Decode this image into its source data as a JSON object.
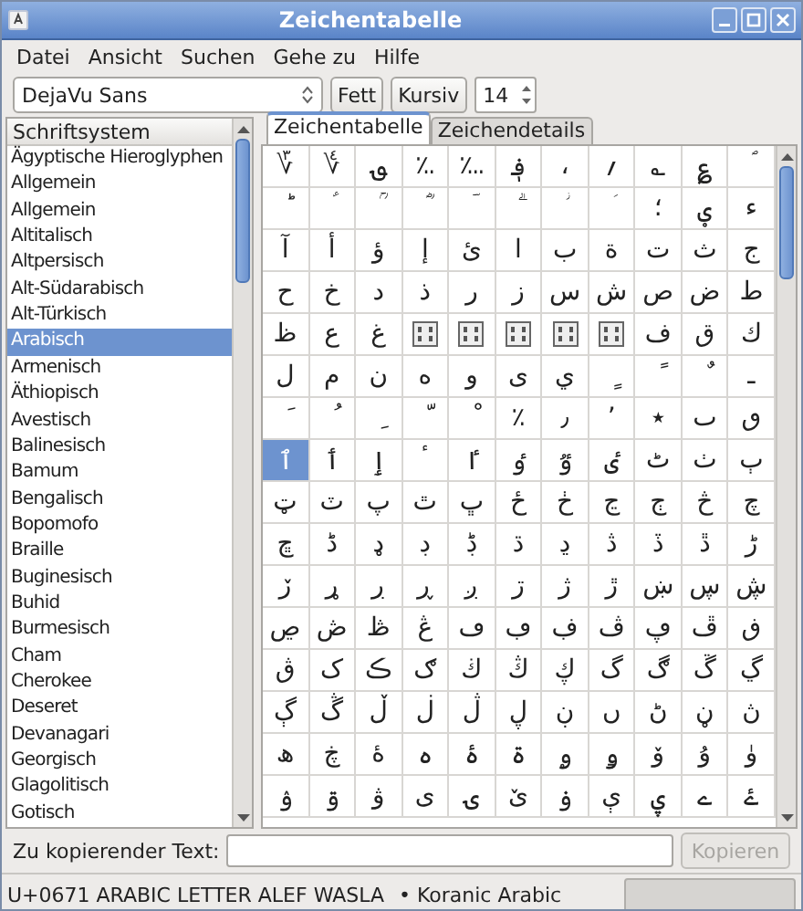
{
  "window": {
    "title": "Zeichentabelle"
  },
  "menu": [
    "Datei",
    "Ansicht",
    "Suchen",
    "Gehe zu",
    "Hilfe"
  ],
  "toolbar": {
    "font": "DejaVu Sans",
    "bold_label": "Fett",
    "italic_label": "Kursiv",
    "size": "14"
  },
  "scripts": {
    "header": "Schriftsystem",
    "items": [
      {
        "label": "Ägyptische Hieroglyphen",
        "selected": false
      },
      {
        "label": "Allgemein",
        "selected": false
      },
      {
        "label": "Allgemein",
        "selected": false
      },
      {
        "label": "Altitalisch",
        "selected": false
      },
      {
        "label": "Altpersisch",
        "selected": false
      },
      {
        "label": "Alt-Südarabisch",
        "selected": false
      },
      {
        "label": "Alt-Türkisch",
        "selected": false
      },
      {
        "label": "Arabisch",
        "selected": true
      },
      {
        "label": "Armenisch",
        "selected": false
      },
      {
        "label": "Äthiopisch",
        "selected": false
      },
      {
        "label": "Avestisch",
        "selected": false
      },
      {
        "label": "Balinesisch",
        "selected": false
      },
      {
        "label": "Bamum",
        "selected": false
      },
      {
        "label": "Bengalisch",
        "selected": false
      },
      {
        "label": "Bopomofo",
        "selected": false
      },
      {
        "label": "Braille",
        "selected": false
      },
      {
        "label": "Buginesisch",
        "selected": false
      },
      {
        "label": "Buhid",
        "selected": false
      },
      {
        "label": "Burmesisch",
        "selected": false
      },
      {
        "label": "Cham",
        "selected": false
      },
      {
        "label": "Cherokee",
        "selected": false
      },
      {
        "label": "Deseret",
        "selected": false
      },
      {
        "label": "Devanagari",
        "selected": false
      },
      {
        "label": "Georgisch",
        "selected": false
      },
      {
        "label": "Glagolitisch",
        "selected": false
      },
      {
        "label": "Gotisch",
        "selected": false
      }
    ]
  },
  "tabs": [
    {
      "label": "Zeichentabelle",
      "selected": true
    },
    {
      "label": "Zeichendetails",
      "selected": false
    }
  ],
  "grid": {
    "rows": [
      [
        {
          "kind": "glyph",
          "char": "؆",
          "selected": false
        },
        {
          "kind": "glyph",
          "char": "؇",
          "selected": false
        },
        {
          "kind": "glyph",
          "char": "؈",
          "selected": false
        },
        {
          "kind": "glyph",
          "char": "؉",
          "selected": false
        },
        {
          "kind": "glyph",
          "char": "؊",
          "selected": false
        },
        {
          "kind": "glyph",
          "char": "؋",
          "selected": false
        },
        {
          "kind": "glyph",
          "char": "،",
          "selected": false
        },
        {
          "kind": "glyph",
          "char": "؍",
          "selected": false
        },
        {
          "kind": "glyph",
          "char": "؎",
          "selected": false
        },
        {
          "kind": "glyph",
          "char": "؏",
          "selected": false
        },
        {
          "kind": "glyph",
          "char": "ؐ",
          "selected": false
        }
      ],
      [
        {
          "kind": "glyph",
          "char": "ؕ",
          "selected": false
        },
        {
          "kind": "glyph",
          "char": "ؑ",
          "selected": false
        },
        {
          "kind": "glyph",
          "char": "ؒ",
          "selected": false
        },
        {
          "kind": "glyph",
          "char": "ؓ",
          "selected": false
        },
        {
          "kind": "glyph",
          "char": "ؔ",
          "selected": false
        },
        {
          "kind": "glyph",
          "char": "ؖ",
          "selected": false
        },
        {
          "kind": "glyph",
          "char": "ؗ",
          "selected": false
        },
        {
          "kind": "glyph",
          "char": "ؘ",
          "selected": false
        },
        {
          "kind": "glyph",
          "char": "؛",
          "selected": false
        },
        {
          "kind": "glyph",
          "char": "ؠ",
          "selected": false
        },
        {
          "kind": "glyph",
          "char": "ء",
          "selected": false
        }
      ],
      [
        {
          "kind": "glyph",
          "char": "آ",
          "selected": false
        },
        {
          "kind": "glyph",
          "char": "أ",
          "selected": false
        },
        {
          "kind": "glyph",
          "char": "ؤ",
          "selected": false
        },
        {
          "kind": "glyph",
          "char": "إ",
          "selected": false
        },
        {
          "kind": "glyph",
          "char": "ئ",
          "selected": false
        },
        {
          "kind": "glyph",
          "char": "ا",
          "selected": false
        },
        {
          "kind": "glyph",
          "char": "ب",
          "selected": false
        },
        {
          "kind": "glyph",
          "char": "ة",
          "selected": false
        },
        {
          "kind": "glyph",
          "char": "ت",
          "selected": false
        },
        {
          "kind": "glyph",
          "char": "ث",
          "selected": false
        },
        {
          "kind": "glyph",
          "char": "ج",
          "selected": false
        }
      ],
      [
        {
          "kind": "glyph",
          "char": "ح",
          "selected": false
        },
        {
          "kind": "glyph",
          "char": "خ",
          "selected": false
        },
        {
          "kind": "glyph",
          "char": "د",
          "selected": false
        },
        {
          "kind": "glyph",
          "char": "ذ",
          "selected": false
        },
        {
          "kind": "glyph",
          "char": "ر",
          "selected": false
        },
        {
          "kind": "glyph",
          "char": "ز",
          "selected": false
        },
        {
          "kind": "glyph",
          "char": "س",
          "selected": false
        },
        {
          "kind": "glyph",
          "char": "ش",
          "selected": false
        },
        {
          "kind": "glyph",
          "char": "ص",
          "selected": false
        },
        {
          "kind": "glyph",
          "char": "ض",
          "selected": false
        },
        {
          "kind": "glyph",
          "char": "ط",
          "selected": false
        }
      ],
      [
        {
          "kind": "glyph",
          "char": "ظ",
          "selected": false
        },
        {
          "kind": "glyph",
          "char": "ع",
          "selected": false
        },
        {
          "kind": "glyph",
          "char": "غ",
          "selected": false
        },
        {
          "kind": "missing",
          "selected": false
        },
        {
          "kind": "missing",
          "selected": false
        },
        {
          "kind": "missing",
          "selected": false
        },
        {
          "kind": "missing",
          "selected": false
        },
        {
          "kind": "missing",
          "selected": false
        },
        {
          "kind": "glyph",
          "char": "ف",
          "selected": false
        },
        {
          "kind": "glyph",
          "char": "ق",
          "selected": false
        },
        {
          "kind": "glyph",
          "char": "ك",
          "selected": false
        }
      ],
      [
        {
          "kind": "glyph",
          "char": "ل",
          "selected": false
        },
        {
          "kind": "glyph",
          "char": "م",
          "selected": false
        },
        {
          "kind": "glyph",
          "char": "ن",
          "selected": false
        },
        {
          "kind": "glyph",
          "char": "ه",
          "selected": false
        },
        {
          "kind": "glyph",
          "char": "و",
          "selected": false
        },
        {
          "kind": "glyph",
          "char": "ى",
          "selected": false
        },
        {
          "kind": "glyph",
          "char": "ي",
          "selected": false
        },
        {
          "kind": "glyph",
          "char": "ٍ",
          "selected": false
        },
        {
          "kind": "glyph",
          "char": "ً",
          "selected": false
        },
        {
          "kind": "glyph",
          "char": "ٌ",
          "selected": false
        },
        {
          "kind": "glyph",
          "char": "ـ",
          "selected": false
        }
      ],
      [
        {
          "kind": "glyph",
          "char": "َ",
          "selected": false
        },
        {
          "kind": "glyph",
          "char": "ُ",
          "selected": false
        },
        {
          "kind": "glyph",
          "char": "ِ",
          "selected": false
        },
        {
          "kind": "glyph",
          "char": "ّ",
          "selected": false
        },
        {
          "kind": "glyph",
          "char": "ْ",
          "selected": false
        },
        {
          "kind": "glyph",
          "char": "٪",
          "selected": false
        },
        {
          "kind": "glyph",
          "char": "٫",
          "selected": false
        },
        {
          "kind": "glyph",
          "char": "٬",
          "selected": false
        },
        {
          "kind": "glyph",
          "char": "٭",
          "selected": false
        },
        {
          "kind": "glyph",
          "char": "ٮ",
          "selected": false
        },
        {
          "kind": "glyph",
          "char": "ٯ",
          "selected": false
        }
      ],
      [
        {
          "kind": "glyph",
          "char": "ٱ",
          "selected": true
        },
        {
          "kind": "glyph",
          "char": "ٲ",
          "selected": false
        },
        {
          "kind": "glyph",
          "char": "ٳ",
          "selected": false
        },
        {
          "kind": "glyph",
          "char": "ٴ",
          "selected": false
        },
        {
          "kind": "glyph",
          "char": "ٵ",
          "selected": false
        },
        {
          "kind": "glyph",
          "char": "ٶ",
          "selected": false
        },
        {
          "kind": "glyph",
          "char": "ٷ",
          "selected": false
        },
        {
          "kind": "glyph",
          "char": "ٸ",
          "selected": false
        },
        {
          "kind": "glyph",
          "char": "ٹ",
          "selected": false
        },
        {
          "kind": "glyph",
          "char": "ٺ",
          "selected": false
        },
        {
          "kind": "glyph",
          "char": "ٻ",
          "selected": false
        }
      ],
      [
        {
          "kind": "glyph",
          "char": "ټ",
          "selected": false
        },
        {
          "kind": "glyph",
          "char": "ٽ",
          "selected": false
        },
        {
          "kind": "glyph",
          "char": "پ",
          "selected": false
        },
        {
          "kind": "glyph",
          "char": "ٿ",
          "selected": false
        },
        {
          "kind": "glyph",
          "char": "ڀ",
          "selected": false
        },
        {
          "kind": "glyph",
          "char": "ځ",
          "selected": false
        },
        {
          "kind": "glyph",
          "char": "ڂ",
          "selected": false
        },
        {
          "kind": "glyph",
          "char": "ڃ",
          "selected": false
        },
        {
          "kind": "glyph",
          "char": "ڄ",
          "selected": false
        },
        {
          "kind": "glyph",
          "char": "څ",
          "selected": false
        },
        {
          "kind": "glyph",
          "char": "چ",
          "selected": false
        }
      ],
      [
        {
          "kind": "glyph",
          "char": "ڇ",
          "selected": false
        },
        {
          "kind": "glyph",
          "char": "ڈ",
          "selected": false
        },
        {
          "kind": "glyph",
          "char": "ډ",
          "selected": false
        },
        {
          "kind": "glyph",
          "char": "ڊ",
          "selected": false
        },
        {
          "kind": "glyph",
          "char": "ڋ",
          "selected": false
        },
        {
          "kind": "glyph",
          "char": "ڌ",
          "selected": false
        },
        {
          "kind": "glyph",
          "char": "ڍ",
          "selected": false
        },
        {
          "kind": "glyph",
          "char": "ڎ",
          "selected": false
        },
        {
          "kind": "glyph",
          "char": "ڏ",
          "selected": false
        },
        {
          "kind": "glyph",
          "char": "ڐ",
          "selected": false
        },
        {
          "kind": "glyph",
          "char": "ڑ",
          "selected": false
        }
      ],
      [
        {
          "kind": "glyph",
          "char": "ڒ",
          "selected": false
        },
        {
          "kind": "glyph",
          "char": "ړ",
          "selected": false
        },
        {
          "kind": "glyph",
          "char": "ڔ",
          "selected": false
        },
        {
          "kind": "glyph",
          "char": "ڕ",
          "selected": false
        },
        {
          "kind": "glyph",
          "char": "ږ",
          "selected": false
        },
        {
          "kind": "glyph",
          "char": "ڗ",
          "selected": false
        },
        {
          "kind": "glyph",
          "char": "ژ",
          "selected": false
        },
        {
          "kind": "glyph",
          "char": "ڙ",
          "selected": false
        },
        {
          "kind": "glyph",
          "char": "ښ",
          "selected": false
        },
        {
          "kind": "glyph",
          "char": "ڛ",
          "selected": false
        },
        {
          "kind": "glyph",
          "char": "ڜ",
          "selected": false
        }
      ],
      [
        {
          "kind": "glyph",
          "char": "ڝ",
          "selected": false
        },
        {
          "kind": "glyph",
          "char": "ڞ",
          "selected": false
        },
        {
          "kind": "glyph",
          "char": "ڟ",
          "selected": false
        },
        {
          "kind": "glyph",
          "char": "ڠ",
          "selected": false
        },
        {
          "kind": "glyph",
          "char": "ڡ",
          "selected": false
        },
        {
          "kind": "glyph",
          "char": "ڢ",
          "selected": false
        },
        {
          "kind": "glyph",
          "char": "ڣ",
          "selected": false
        },
        {
          "kind": "glyph",
          "char": "ڤ",
          "selected": false
        },
        {
          "kind": "glyph",
          "char": "ڥ",
          "selected": false
        },
        {
          "kind": "glyph",
          "char": "ڦ",
          "selected": false
        },
        {
          "kind": "glyph",
          "char": "ڧ",
          "selected": false
        }
      ],
      [
        {
          "kind": "glyph",
          "char": "ڨ",
          "selected": false
        },
        {
          "kind": "glyph",
          "char": "ک",
          "selected": false
        },
        {
          "kind": "glyph",
          "char": "ڪ",
          "selected": false
        },
        {
          "kind": "glyph",
          "char": "ګ",
          "selected": false
        },
        {
          "kind": "glyph",
          "char": "ڬ",
          "selected": false
        },
        {
          "kind": "glyph",
          "char": "ڭ",
          "selected": false
        },
        {
          "kind": "glyph",
          "char": "ڮ",
          "selected": false
        },
        {
          "kind": "glyph",
          "char": "گ",
          "selected": false
        },
        {
          "kind": "glyph",
          "char": "ڰ",
          "selected": false
        },
        {
          "kind": "glyph",
          "char": "ڱ",
          "selected": false
        },
        {
          "kind": "glyph",
          "char": "ڲ",
          "selected": false
        }
      ],
      [
        {
          "kind": "glyph",
          "char": "ڳ",
          "selected": false
        },
        {
          "kind": "glyph",
          "char": "ڴ",
          "selected": false
        },
        {
          "kind": "glyph",
          "char": "ڵ",
          "selected": false
        },
        {
          "kind": "glyph",
          "char": "ڶ",
          "selected": false
        },
        {
          "kind": "glyph",
          "char": "ڷ",
          "selected": false
        },
        {
          "kind": "glyph",
          "char": "ڸ",
          "selected": false
        },
        {
          "kind": "glyph",
          "char": "ڹ",
          "selected": false
        },
        {
          "kind": "glyph",
          "char": "ں",
          "selected": false
        },
        {
          "kind": "glyph",
          "char": "ڻ",
          "selected": false
        },
        {
          "kind": "glyph",
          "char": "ڼ",
          "selected": false
        },
        {
          "kind": "glyph",
          "char": "ڽ",
          "selected": false
        }
      ],
      [
        {
          "kind": "glyph",
          "char": "ھ",
          "selected": false
        },
        {
          "kind": "glyph",
          "char": "ڿ",
          "selected": false
        },
        {
          "kind": "glyph",
          "char": "ۀ",
          "selected": false
        },
        {
          "kind": "glyph",
          "char": "ہ",
          "selected": false
        },
        {
          "kind": "glyph",
          "char": "ۂ",
          "selected": false
        },
        {
          "kind": "glyph",
          "char": "ۃ",
          "selected": false
        },
        {
          "kind": "glyph",
          "char": "ۄ",
          "selected": false
        },
        {
          "kind": "glyph",
          "char": "ۅ",
          "selected": false
        },
        {
          "kind": "glyph",
          "char": "ۆ",
          "selected": false
        },
        {
          "kind": "glyph",
          "char": "ۇ",
          "selected": false
        },
        {
          "kind": "glyph",
          "char": "ۈ",
          "selected": false
        }
      ],
      [
        {
          "kind": "glyph",
          "char": "ۉ",
          "selected": false
        },
        {
          "kind": "glyph",
          "char": "ۊ",
          "selected": false
        },
        {
          "kind": "glyph",
          "char": "ۋ",
          "selected": false
        },
        {
          "kind": "glyph",
          "char": "ی",
          "selected": false
        },
        {
          "kind": "glyph",
          "char": "ۍ",
          "selected": false
        },
        {
          "kind": "glyph",
          "char": "ێ",
          "selected": false
        },
        {
          "kind": "glyph",
          "char": "ۏ",
          "selected": false
        },
        {
          "kind": "glyph",
          "char": "ې",
          "selected": false
        },
        {
          "kind": "glyph",
          "char": "ۑ",
          "selected": false
        },
        {
          "kind": "glyph",
          "char": "ے",
          "selected": false
        },
        {
          "kind": "glyph",
          "char": "ۓ",
          "selected": false
        }
      ]
    ]
  },
  "copy": {
    "label": "Zu kopierender Text:",
    "button": "Kopieren",
    "disabled": true
  },
  "status": {
    "codepoint": "U+0671 ARABIC LETTER ALEF WASLA",
    "note": "• Koranic Arabic"
  }
}
